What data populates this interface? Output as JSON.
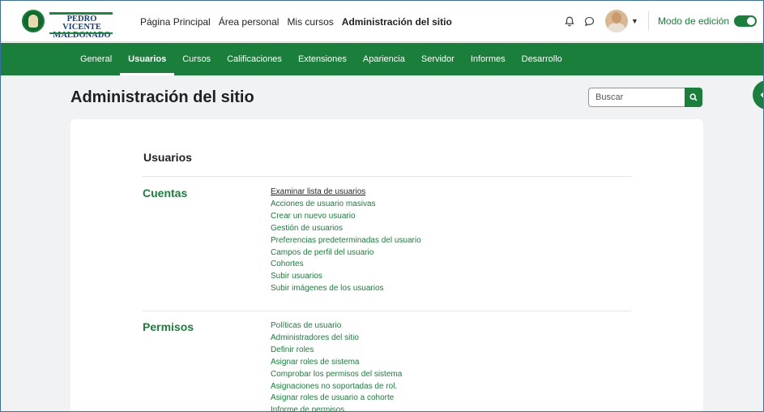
{
  "logo": {
    "line1": "PEDRO VICENTE",
    "line2": "MALDONADO"
  },
  "nav": {
    "items": [
      {
        "label": "Página Principal",
        "active": false
      },
      {
        "label": "Área personal",
        "active": false
      },
      {
        "label": "Mis cursos",
        "active": false
      },
      {
        "label": "Administración del sitio",
        "active": true
      }
    ]
  },
  "header_icons": [
    "bell-icon",
    "chat-bubble-icon"
  ],
  "edit_mode": {
    "label": "Modo de edición",
    "on": true
  },
  "secondary_nav": {
    "items": [
      {
        "label": "General",
        "active": false
      },
      {
        "label": "Usuarios",
        "active": true
      },
      {
        "label": "Cursos",
        "active": false
      },
      {
        "label": "Calificaciones",
        "active": false
      },
      {
        "label": "Extensiones",
        "active": false
      },
      {
        "label": "Apariencia",
        "active": false
      },
      {
        "label": "Servidor",
        "active": false
      },
      {
        "label": "Informes",
        "active": false
      },
      {
        "label": "Desarrollo",
        "active": false
      }
    ]
  },
  "page": {
    "title": "Administración del sitio"
  },
  "search": {
    "placeholder": "Buscar",
    "value": ""
  },
  "content": {
    "section_heading": "Usuarios",
    "categories": [
      {
        "title": "Cuentas",
        "links": [
          "Examinar lista de usuarios",
          "Acciones de usuario masivas",
          "Crear un nuevo usuario",
          "Gestión de usuarios",
          "Preferencias predeterminadas del usuario",
          "Campos de perfil del usuario",
          "Cohortes",
          "Subir usuarios",
          "Subir imágenes de los usuarios"
        ]
      },
      {
        "title": "Permisos",
        "links": [
          "Políticas de usuario",
          "Administradores del sitio",
          "Definir roles",
          "Asignar roles de sistema",
          "Comprobar los permisos del sistema",
          "Asignaciones no soportadas de rol.",
          "Asignar roles de usuario a cohorte",
          "Informe de permisos"
        ]
      }
    ]
  },
  "colors": {
    "brand_green": "#1a7f3a",
    "logo_blue": "#123f8a",
    "background": "#f1f2f4"
  }
}
